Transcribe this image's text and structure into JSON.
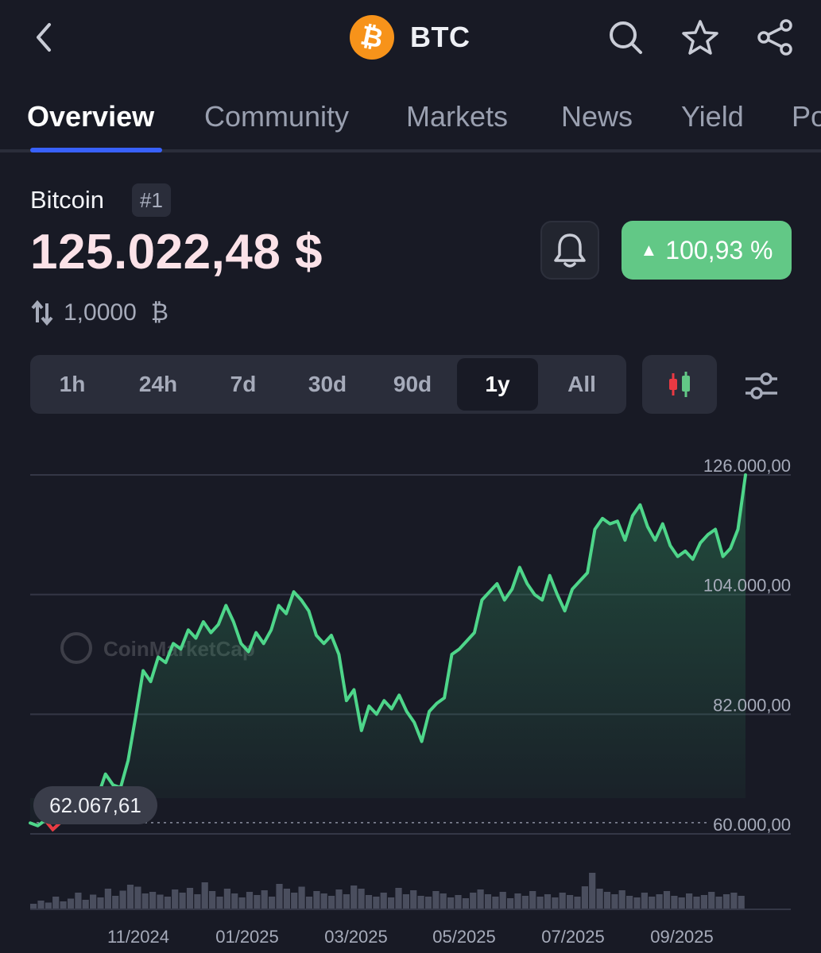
{
  "header": {
    "symbol": "BTC",
    "coin_glyph": "₿",
    "icons": [
      "back-icon",
      "search-icon",
      "star-icon",
      "share-icon"
    ]
  },
  "tabs": [
    {
      "label": "Overview",
      "active": true
    },
    {
      "label": "Community",
      "active": false
    },
    {
      "label": "Markets",
      "active": false
    },
    {
      "label": "News",
      "active": false
    },
    {
      "label": "Yield",
      "active": false
    },
    {
      "label": "Po",
      "active": false
    }
  ],
  "coin": {
    "name": "Bitcoin",
    "rank": "#1",
    "price": "125.022,48 $",
    "change": "100,93 %",
    "change_direction": "up",
    "conversion": "1,0000",
    "conversion_unit": "₿"
  },
  "ranges": {
    "options": [
      "1h",
      "24h",
      "7d",
      "30d",
      "90d",
      "1y",
      "All"
    ],
    "selected": "1y"
  },
  "colors": {
    "background": "#181a25",
    "accent": "#3861fb",
    "up": "#62c886",
    "line": "#4ed68a",
    "down": "#ea3943",
    "price_text": "#fbe2e8"
  },
  "chart_data": {
    "type": "area",
    "title": "",
    "watermark": "CoinMarketCap",
    "yticks": [
      "126.000,00",
      "104.000,00",
      "82.000,00",
      "60.000,00"
    ],
    "ytick_values": [
      126000,
      104000,
      82000,
      60000
    ],
    "ylim": [
      60000,
      126000
    ],
    "xticks": [
      "11/2024",
      "01/2025",
      "03/2025",
      "05/2025",
      "07/2025",
      "09/2025"
    ],
    "start_label": "62.067,61",
    "reference_value": 62067.61,
    "grid": true,
    "series": [
      {
        "values": [
          62000,
          61500,
          62500,
          60800,
          62067,
          64500,
          63500,
          66500,
          67800,
          67000,
          71000,
          69000,
          68500,
          73500,
          81500,
          90000,
          88000,
          92500,
          91500,
          95000,
          94000,
          97500,
          96000,
          99000,
          97000,
          98500,
          102000,
          99000,
          95000,
          93500,
          97000,
          95000,
          97500,
          102000,
          100500,
          104500,
          103000,
          101000,
          96500,
          95000,
          96500,
          93000,
          84500,
          86500,
          79000,
          83500,
          82000,
          84500,
          83000,
          85500,
          82500,
          80500,
          77000,
          82500,
          84000,
          85000,
          93000,
          94000,
          95500,
          97000,
          103000,
          104500,
          106000,
          103000,
          105000,
          109000,
          106000,
          104000,
          103000,
          107500,
          104000,
          101000,
          105000,
          106500,
          108000,
          116000,
          118000,
          117000,
          117500,
          114000,
          118500,
          120500,
          116500,
          114000,
          117000,
          113000,
          111000,
          112000,
          110500,
          113500,
          115000,
          116000,
          111000,
          112500,
          116000,
          126000
        ],
        "volumes": [
          0.12,
          0.2,
          0.15,
          0.3,
          0.18,
          0.25,
          0.4,
          0.22,
          0.35,
          0.28,
          0.5,
          0.32,
          0.45,
          0.6,
          0.55,
          0.38,
          0.42,
          0.35,
          0.3,
          0.48,
          0.4,
          0.52,
          0.36,
          0.66,
          0.44,
          0.3,
          0.5,
          0.38,
          0.28,
          0.42,
          0.34,
          0.46,
          0.3,
          0.62,
          0.5,
          0.4,
          0.55,
          0.3,
          0.44,
          0.38,
          0.32,
          0.48,
          0.36,
          0.58,
          0.5,
          0.34,
          0.3,
          0.4,
          0.28,
          0.52,
          0.36,
          0.46,
          0.32,
          0.3,
          0.44,
          0.38,
          0.28,
          0.34,
          0.26,
          0.4,
          0.48,
          0.36,
          0.3,
          0.42,
          0.26,
          0.38,
          0.32,
          0.44,
          0.3,
          0.36,
          0.28,
          0.4,
          0.34,
          0.3,
          0.56,
          0.9,
          0.5,
          0.42,
          0.36,
          0.46,
          0.32,
          0.28,
          0.4,
          0.3,
          0.36,
          0.44,
          0.32,
          0.28,
          0.38,
          0.3,
          0.34,
          0.42,
          0.3,
          0.36,
          0.4,
          0.32
        ]
      }
    ]
  }
}
